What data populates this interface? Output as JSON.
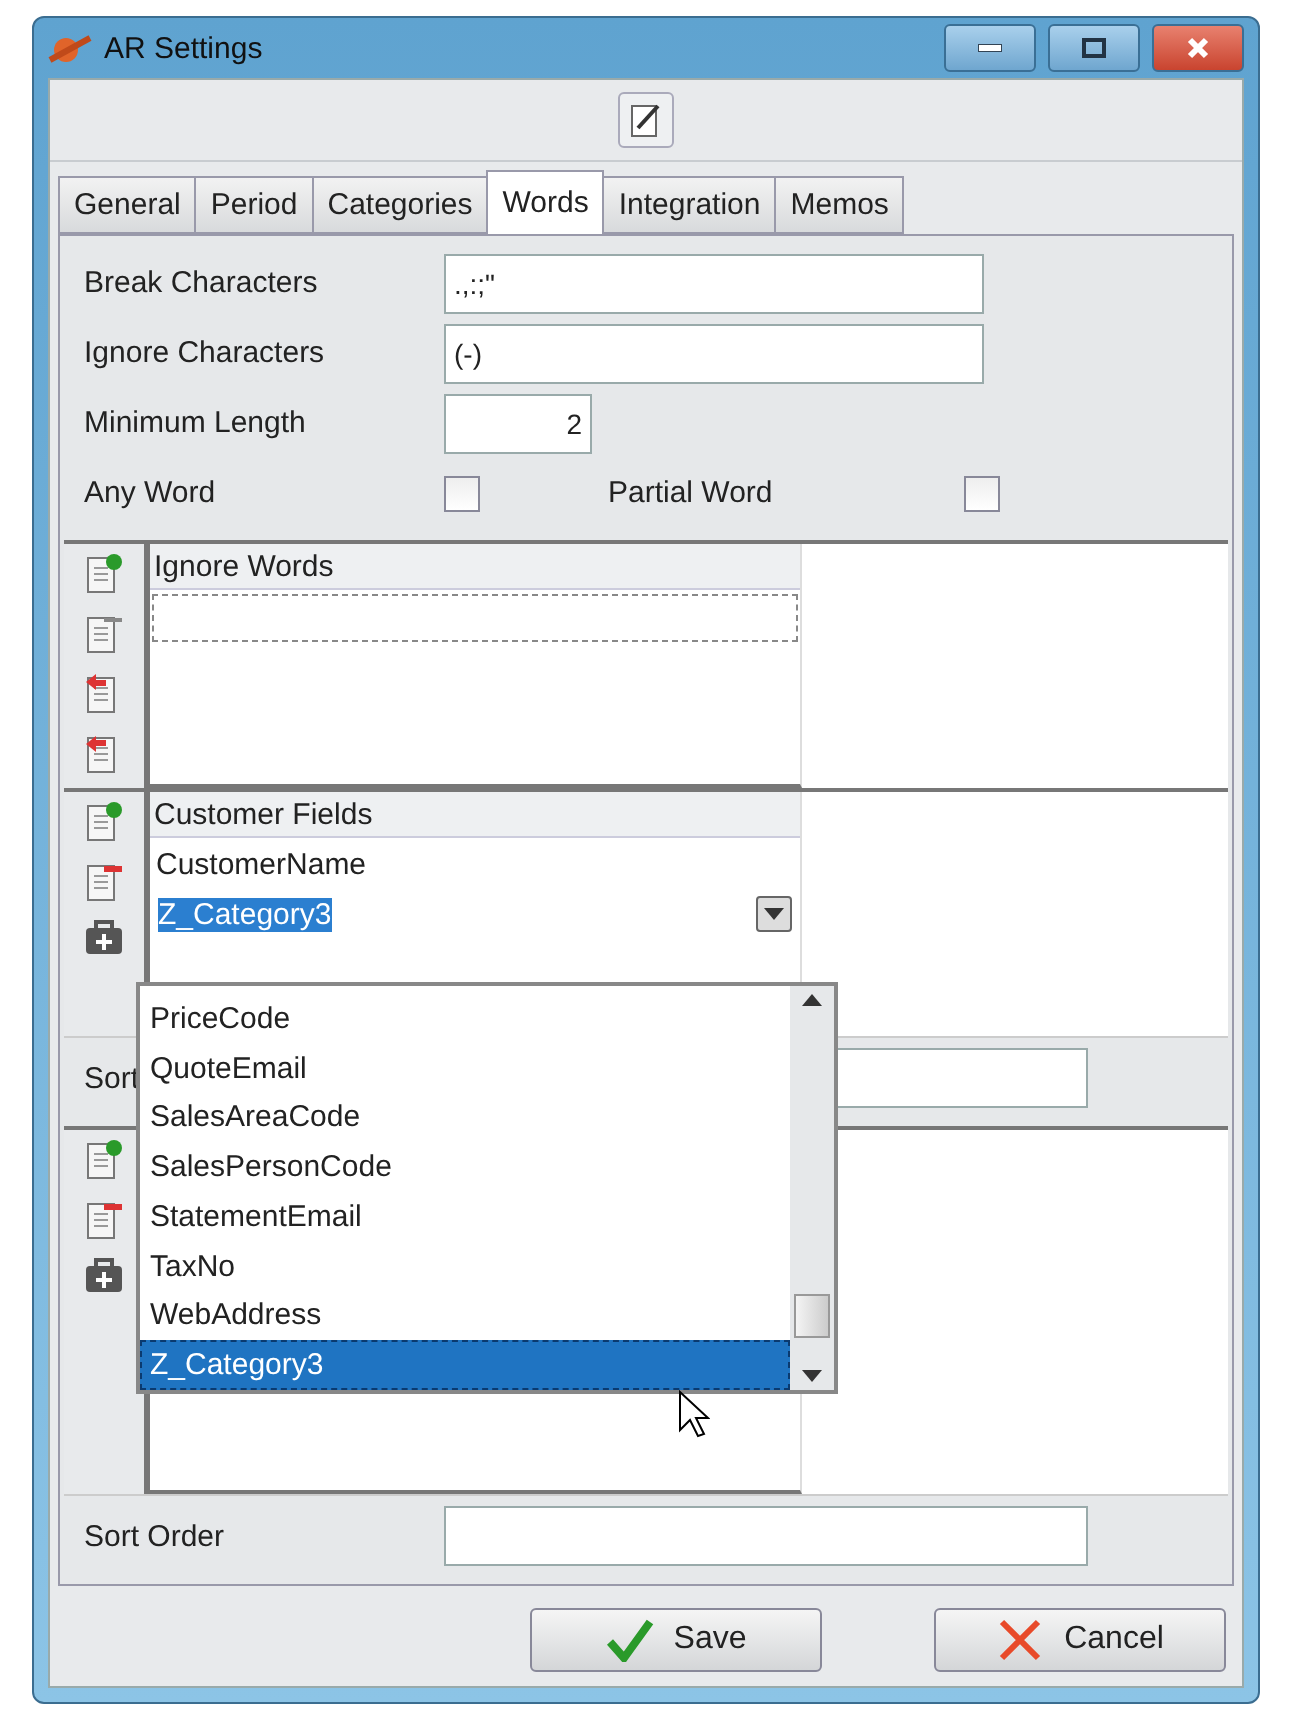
{
  "window": {
    "title": "AR Settings"
  },
  "tabs": [
    {
      "label": "General",
      "selected": false
    },
    {
      "label": "Period",
      "selected": false
    },
    {
      "label": "Categories",
      "selected": false
    },
    {
      "label": "Words",
      "selected": true
    },
    {
      "label": "Integration",
      "selected": false
    },
    {
      "label": "Memos",
      "selected": false
    }
  ],
  "form": {
    "break_characters": {
      "label": "Break Characters",
      "value": ".,:;\""
    },
    "ignore_characters": {
      "label": "Ignore Characters",
      "value": "(-)"
    },
    "minimum_length": {
      "label": "Minimum Length",
      "value": "2"
    },
    "any_word": {
      "label": "Any Word",
      "checked": false
    },
    "partial_word": {
      "label": "Partial Word",
      "checked": false
    }
  },
  "ignore_words": {
    "header": "Ignore Words"
  },
  "customer_fields": {
    "header": "Customer Fields",
    "rows": [
      "CustomerName"
    ],
    "editor": {
      "value": "Z_Category3"
    },
    "sort_label": "Sort"
  },
  "dropdown": {
    "items": [
      {
        "label": "PriceCode",
        "selected": false
      },
      {
        "label": "QuoteEmail",
        "selected": false
      },
      {
        "label": "SalesAreaCode",
        "selected": false
      },
      {
        "label": "SalesPersonCode",
        "selected": false
      },
      {
        "label": "StatementEmail",
        "selected": false
      },
      {
        "label": "TaxNo",
        "selected": false
      },
      {
        "label": "WebAddress",
        "selected": false
      },
      {
        "label": "Z_Category3",
        "selected": true
      }
    ]
  },
  "sort_order": {
    "label": "Sort Order"
  },
  "buttons": [
    {
      "kind": "save",
      "label": "Save"
    },
    {
      "kind": "cancel",
      "label": "Cancel"
    }
  ]
}
